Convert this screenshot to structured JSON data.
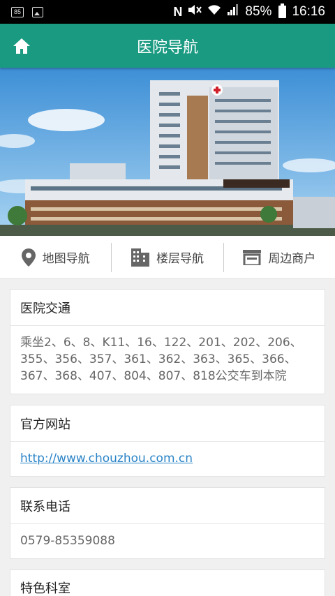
{
  "status_bar": {
    "badge": "85",
    "network": "N",
    "battery_percent": "85%",
    "time": "16:16"
  },
  "app_bar": {
    "title": "医院导航",
    "home_icon": "home-icon"
  },
  "nav": {
    "items": [
      {
        "label": "地图导航",
        "icon": "map-pin-icon"
      },
      {
        "label": "楼层导航",
        "icon": "building-icon"
      },
      {
        "label": "周边商户",
        "icon": "shop-icon"
      }
    ]
  },
  "cards": [
    {
      "title": "医院交通",
      "body": "乘坐2、6、8、K11、16、122、201、202、206、355、356、357、361、362、363、365、366、367、368、407、804、807、818公交车到本院"
    },
    {
      "title": "官方网站",
      "link": "http://www.chouzhou.com.cn"
    },
    {
      "title": "联系电话",
      "body": "0579-85359088"
    },
    {
      "title": "特色科室"
    }
  ],
  "colors": {
    "app_bar": "#1b9a82",
    "link": "#2a84c7"
  }
}
